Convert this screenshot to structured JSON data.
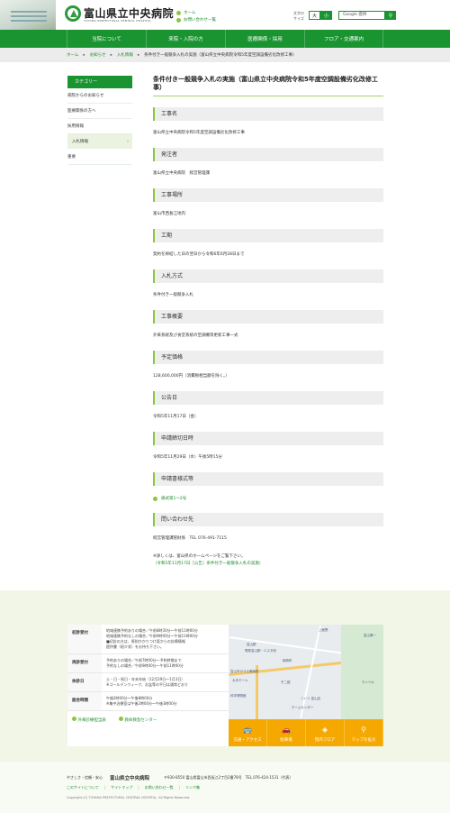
{
  "header": {
    "logo_text": "富山県立中央病院",
    "logo_sub": "TOYAMA PREFECTURAL CENTRAL HOSPITAL",
    "links": [
      "ホーム",
      "お問い合わせ一覧"
    ],
    "font_size_label": "文字の サイズ",
    "font_large": "大",
    "font_small": "小",
    "search_placeholder": "Google 提供",
    "search_icon": "search-icon"
  },
  "nav": [
    "当院について",
    "来院・入院の方",
    "医療関係・採用",
    "フロア・交通案内"
  ],
  "breadcrumb": [
    "ホーム",
    "お知らせ",
    "入札情報",
    "条件付き一般競争入札の実施（富山県立中央病院令和5年度空調設備劣化改修工事）"
  ],
  "sidebar": {
    "heading": "カテゴリー",
    "items": [
      "病院からのお知らせ",
      "医療関係の方へ",
      "採用情報",
      "入札情報",
      "重要"
    ],
    "active": "入札情報"
  },
  "article": {
    "title": "条件付き一般競争入札の実施（富山県立中央病院令和5年度空調設備劣化改修工事）",
    "sections": [
      {
        "h": "工事名",
        "t": "富山県立中央病院令和5年度空調設備劣化改修工事"
      },
      {
        "h": "発注者",
        "t": "富山県立中央病院　経営管理課"
      },
      {
        "h": "工事場所",
        "t": "富山市西長江地内"
      },
      {
        "h": "工期",
        "t": "契約を締結した日の翌日から令和6年6月28日まで"
      },
      {
        "h": "入札方式",
        "t": "条件付き一般競争入札"
      },
      {
        "h": "工事概要",
        "t": "外来系統及び食堂系統の空調機等更新工事一式"
      },
      {
        "h": "予定価格",
        "t": "128,600,000円（消費税相当額を除く。）"
      },
      {
        "h": "公告日",
        "t": "令和5年11月17日（金）"
      },
      {
        "h": "申請締切日時",
        "t": "令和5年11月29日（水）午後5時15分"
      },
      {
        "h": "申請書様式等",
        "t": "様式第1～2号",
        "link": true
      },
      {
        "h": "問い合わせ先",
        "t": "経営管理課管財係　TEL 076-491-7115"
      }
    ],
    "note": "※詳しくは、富山県のホームページをご覧下さい。",
    "note_link": "（令和5年11月17日［公告］条件付き一般競争入札の実施）"
  },
  "info": {
    "rows": [
      {
        "k": "初診受付",
        "v": [
          "地域連携予約ありの場合／午前8時30分～午前11時00分",
          "地域連携予約なしの場合／午前9時00分～午前11時00分",
          "■初診の方は、原則かかりつけ医からの診療情報",
          "提供書（紹介状）をお持ち下さい。"
        ]
      },
      {
        "k": "再診受付",
        "v": [
          "予約ありの場合／午前7時00分～予約時間まで",
          "予約なしの場合／午前9時00分～午前11時00分"
        ]
      },
      {
        "k": "休診日",
        "v": [
          "土・日・祝日・年末年始（12月29日～1月3日）",
          "※ゴールデンウィーク、お盆等の平日は通常どおり"
        ]
      },
      {
        "k": "面会時間",
        "v": [
          "午後2時00分～午後8時00分",
          "※集中治療室は午後2時00分～午後3時00分"
        ]
      }
    ],
    "links": [
      "外来診療担当表",
      "救命救急センター"
    ]
  },
  "map": {
    "labels": [
      "富山駅",
      "電鉄富山駅・エスタ前",
      "稲荷町",
      "富山市ガラス美術館",
      "大手モール",
      "科学博物館",
      "不二越",
      "ニトリ 富山店",
      "ホームセンター",
      "上飯野",
      "モンベル",
      "富山第一"
    ],
    "buttons": [
      {
        "label": "交通・アクセス",
        "icon": "bus-icon"
      },
      {
        "label": "駐車場",
        "icon": "car-icon"
      },
      {
        "label": "院内フロア",
        "icon": "floor-icon"
      },
      {
        "label": "マップを拡大",
        "icon": "map-pin-icon"
      }
    ],
    "accent": "#f5a800"
  },
  "footer": {
    "tagline": "やさしさ・信頼・安心",
    "name": "富山県立中央病院",
    "address": "〒930-8550 富山県富山市西長江2丁目2番78号　TEL.076-424-1531（代表）",
    "links": [
      "このサイトについて",
      "サイトマップ",
      "お問い合わせ一覧",
      "リンク集"
    ],
    "copyright": "Copyright (C) TOYAMA PREFECTURAL CENTRAL HOSPITAL. All Rights Reserved."
  },
  "colors": {
    "green": "#1a9431",
    "lime": "#8cc63f",
    "orange": "#f5a800"
  }
}
